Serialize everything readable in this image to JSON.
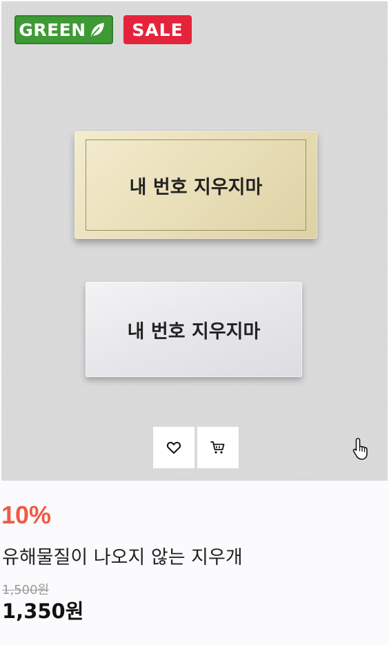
{
  "badges": {
    "green": "GREEN",
    "sale": "SALE"
  },
  "image": {
    "plate_top_text": "내 번호 지우지마",
    "plate_bottom_text": "내 번호 지우지마"
  },
  "actions": {
    "wishlist_icon": "heart-icon",
    "cart_icon": "cart-icon"
  },
  "product": {
    "discount": "10%",
    "name": "유해물질이 나오지 않는 지우개",
    "original_price": "1,500원",
    "sale_price": "1,350원"
  },
  "colors": {
    "green_badge": "#3f9a36",
    "sale_badge": "#e5243c",
    "discount": "#f05a43"
  }
}
